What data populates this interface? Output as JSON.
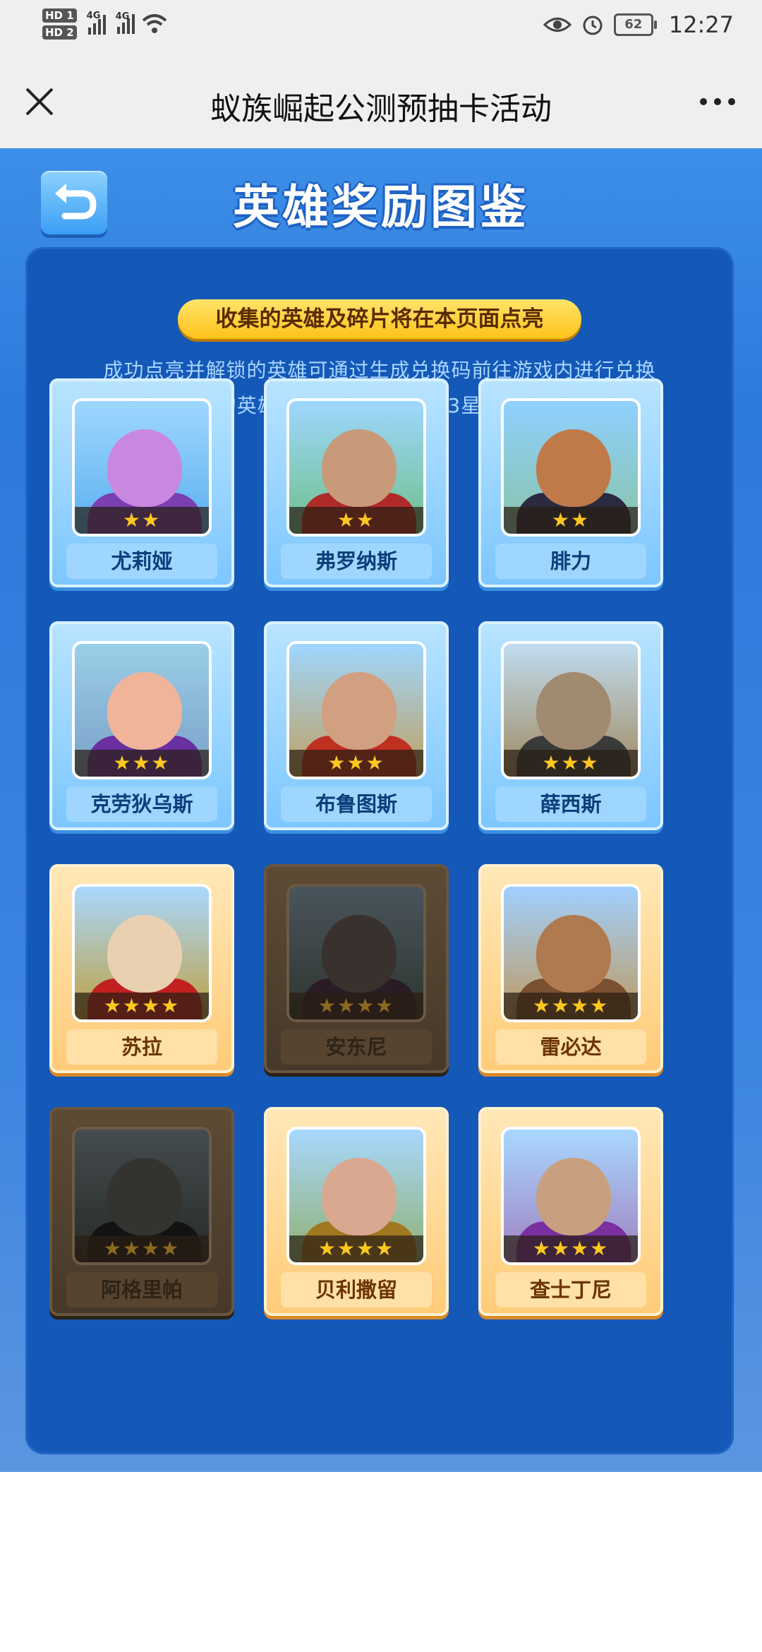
{
  "status_bar": {
    "sim1": "HD 1",
    "sim2": "HD 2",
    "net1": "4G",
    "net2": "4G",
    "battery": "62",
    "time": "12:27"
  },
  "header": {
    "title": "蚁族崛起公测预抽卡活动",
    "close_icon": "close-icon",
    "more_icon": "more-icon"
  },
  "page": {
    "heading": "英雄奖励图鉴",
    "back_icon": "return-arrow-icon",
    "notice": "收集的英雄及碎片将在本页面点亮",
    "description": "成功点亮并解锁的英雄可通过生成兑换码前往游戏内进行兑换（每个星级的英雄只限领1个，2星和3星英雄视为同星级）"
  },
  "heroes": [
    {
      "name": "尤莉娅",
      "stars": "★★",
      "state": "unlocked"
    },
    {
      "name": "弗罗纳斯",
      "stars": "★★",
      "state": "unlocked"
    },
    {
      "name": "腓力",
      "stars": "★★",
      "state": "unlocked"
    },
    {
      "name": "克劳狄乌斯",
      "stars": "★★★",
      "state": "unlocked"
    },
    {
      "name": "布鲁图斯",
      "stars": "★★★",
      "state": "unlocked"
    },
    {
      "name": "薛西斯",
      "stars": "★★★",
      "state": "unlocked"
    },
    {
      "name": "苏拉",
      "stars": "★★★★",
      "state": "unlocked"
    },
    {
      "name": "安东尼",
      "stars": "★★★★",
      "state": "locked"
    },
    {
      "name": "雷必达",
      "stars": "★★★★",
      "state": "unlocked"
    },
    {
      "name": "阿格里帕",
      "stars": "★★★★",
      "state": "locked"
    },
    {
      "name": "贝利撒留",
      "stars": "★★★★",
      "state": "unlocked"
    },
    {
      "name": "查士丁尼",
      "stars": "★★★★",
      "state": "unlocked"
    }
  ],
  "colors": {
    "page_blue": "#3c8fe8",
    "panel_blue": "#1458b8",
    "pill_gold": "#ffc21a",
    "star_gold": "#ffc81f"
  }
}
